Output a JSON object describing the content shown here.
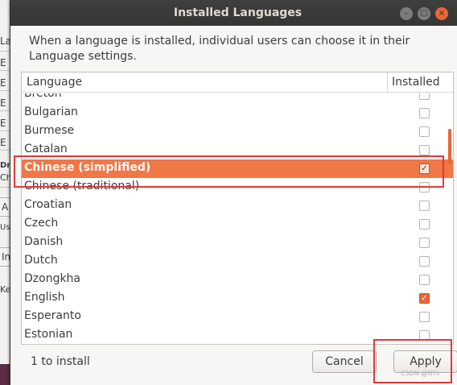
{
  "background": {
    "fragments": [
      "La",
      "La",
      "E",
      "E",
      "E",
      "E",
      "E",
      "Dr",
      "Ch",
      "A",
      "Us",
      "In",
      "Ke"
    ]
  },
  "dialog": {
    "title": "Installed Languages",
    "description": "When a language is installed, individual users can choose it in their Language settings.",
    "columns": {
      "language": "Language",
      "installed": "Installed"
    },
    "languages": [
      {
        "name": "Breton",
        "installed": false,
        "selected": false
      },
      {
        "name": "Bulgarian",
        "installed": false,
        "selected": false
      },
      {
        "name": "Burmese",
        "installed": false,
        "selected": false
      },
      {
        "name": "Catalan",
        "installed": false,
        "selected": false
      },
      {
        "name": "Chinese (simplified)",
        "installed": true,
        "selected": true
      },
      {
        "name": "Chinese (traditional)",
        "installed": false,
        "selected": false
      },
      {
        "name": "Croatian",
        "installed": false,
        "selected": false
      },
      {
        "name": "Czech",
        "installed": false,
        "selected": false
      },
      {
        "name": "Danish",
        "installed": false,
        "selected": false
      },
      {
        "name": "Dutch",
        "installed": false,
        "selected": false
      },
      {
        "name": "Dzongkha",
        "installed": false,
        "selected": false
      },
      {
        "name": "English",
        "installed": true,
        "selected": false
      },
      {
        "name": "Esperanto",
        "installed": false,
        "selected": false
      },
      {
        "name": "Estonian",
        "installed": false,
        "selected": false
      }
    ],
    "status": "1 to install",
    "cancel_label": "Cancel",
    "apply_label": "Apply",
    "check_glyph": "✓"
  },
  "window_controls": {
    "minimize": "–",
    "maximize": "□",
    "close": "×"
  },
  "watermark": "CSDN @NYir",
  "colors": {
    "accent": "#e9653a",
    "selection": "#f07746",
    "highlight_box": "#e03a3a",
    "titlebar": "#3a3a38"
  }
}
